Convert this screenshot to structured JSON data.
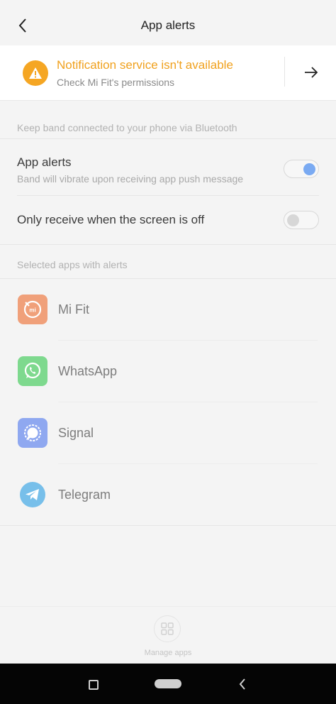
{
  "header": {
    "title": "App alerts"
  },
  "banner": {
    "title": "Notification service isn't available",
    "subtitle": "Check Mi Fit's permissions"
  },
  "sections": {
    "connection_label": "Keep band connected to your phone via Bluetooth",
    "apps_label": "Selected apps with alerts"
  },
  "settings": {
    "app_alerts": {
      "title": "App alerts",
      "subtitle": "Band will vibrate upon receiving app push message",
      "enabled": true
    },
    "screen_off": {
      "title": "Only receive when the screen is off",
      "enabled": false
    }
  },
  "apps": [
    {
      "name": "Mi Fit",
      "icon": "mi-fit-icon",
      "color": "#f0a07a"
    },
    {
      "name": "WhatsApp",
      "icon": "whatsapp-icon",
      "color": "#7ed98e"
    },
    {
      "name": "Signal",
      "icon": "signal-icon",
      "color": "#8fa8f0"
    },
    {
      "name": "Telegram",
      "icon": "telegram-icon",
      "color": "#77bfea"
    }
  ],
  "footer": {
    "manage_label": "Manage apps"
  },
  "colors": {
    "accent": "#f0a11e",
    "toggle_on": "#7aaaf2"
  }
}
